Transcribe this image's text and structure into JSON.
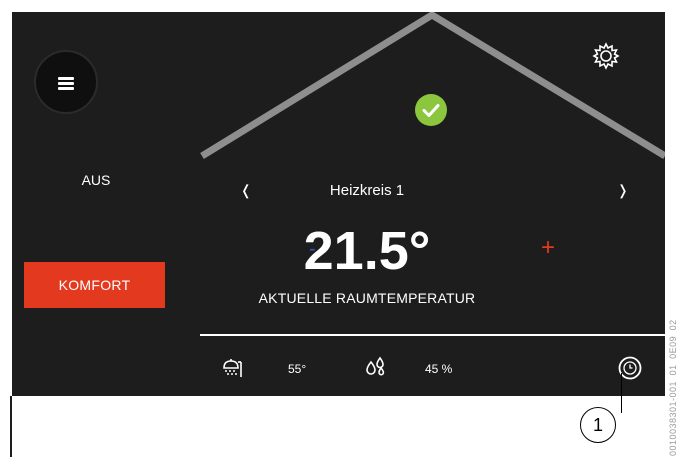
{
  "mode": {
    "status": "AUS",
    "preset_button": "KOMFORT"
  },
  "circuit": {
    "prev": "❬",
    "name": "Heizkreis 1",
    "next": "❭"
  },
  "temperature": {
    "value": "21.5°",
    "label": "AKTUELLE RAUMTEMPERATUR",
    "decrease": "-",
    "increase": "+"
  },
  "status_bar": {
    "water_temp": "55°",
    "humidity": "45 %"
  },
  "icons": {
    "menu": "menu-icon",
    "settings": "gear-icon",
    "ok": "check-icon",
    "shower": "shower-icon",
    "humidity": "droplets-icon",
    "clock": "clock-icon"
  },
  "callout": {
    "number": "1"
  },
  "side_code": "0010038301-001_01_0E09_02",
  "colors": {
    "background": "#1d1d1d",
    "accent_red": "#e33a1f",
    "ok_green": "#8cc63f",
    "roof_gray": "#8e8e8e",
    "minus_blue": "#3355cc"
  }
}
